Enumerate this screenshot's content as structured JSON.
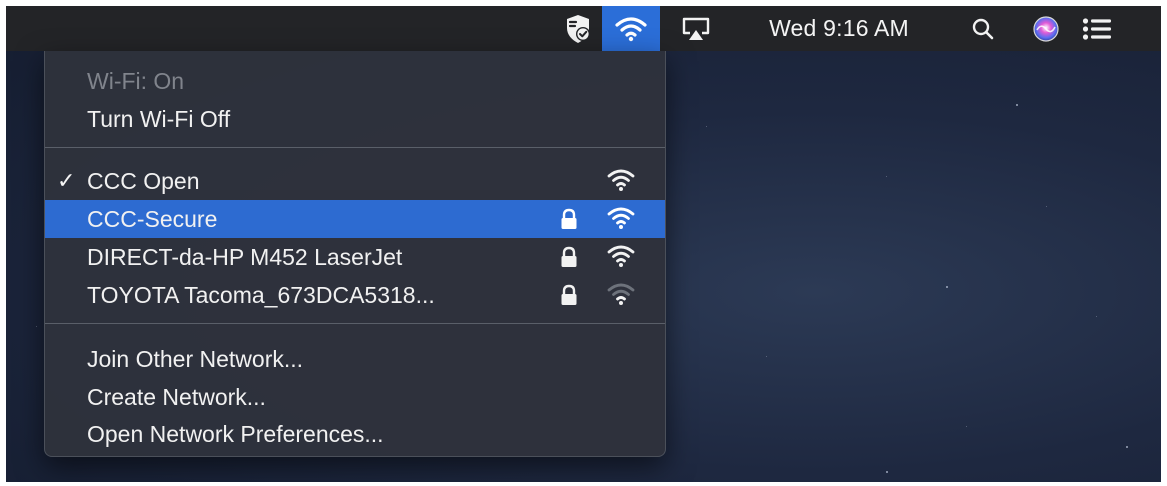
{
  "menubar": {
    "icons": {
      "shield": "shield-check-icon",
      "wifi": "wifi-icon",
      "airplay": "airplay-icon",
      "search": "spotlight-search-icon",
      "siri": "siri-icon",
      "notifications": "notification-center-icon"
    },
    "clock": "Wed 9:16 AM",
    "wifi_active_color": "#2b6ed8"
  },
  "wifi_menu": {
    "status": "Wi-Fi: On",
    "toggle": "Turn Wi-Fi Off",
    "networks": [
      {
        "name": "CCC Open",
        "connected": true,
        "secured": false,
        "signal": "full"
      },
      {
        "name": "CCC-Secure",
        "connected": false,
        "secured": true,
        "signal": "full",
        "highlighted": true
      },
      {
        "name": "DIRECT-da-HP M452 LaserJet",
        "connected": false,
        "secured": true,
        "signal": "full"
      },
      {
        "name": "TOYOTA Tacoma_673DCA5318...",
        "connected": false,
        "secured": true,
        "signal": "weak"
      }
    ],
    "check_mark": "✓",
    "actions": {
      "join_other": "Join Other Network...",
      "create": "Create Network...",
      "preferences": "Open Network Preferences..."
    },
    "highlight_color": "#2d6bd1"
  }
}
